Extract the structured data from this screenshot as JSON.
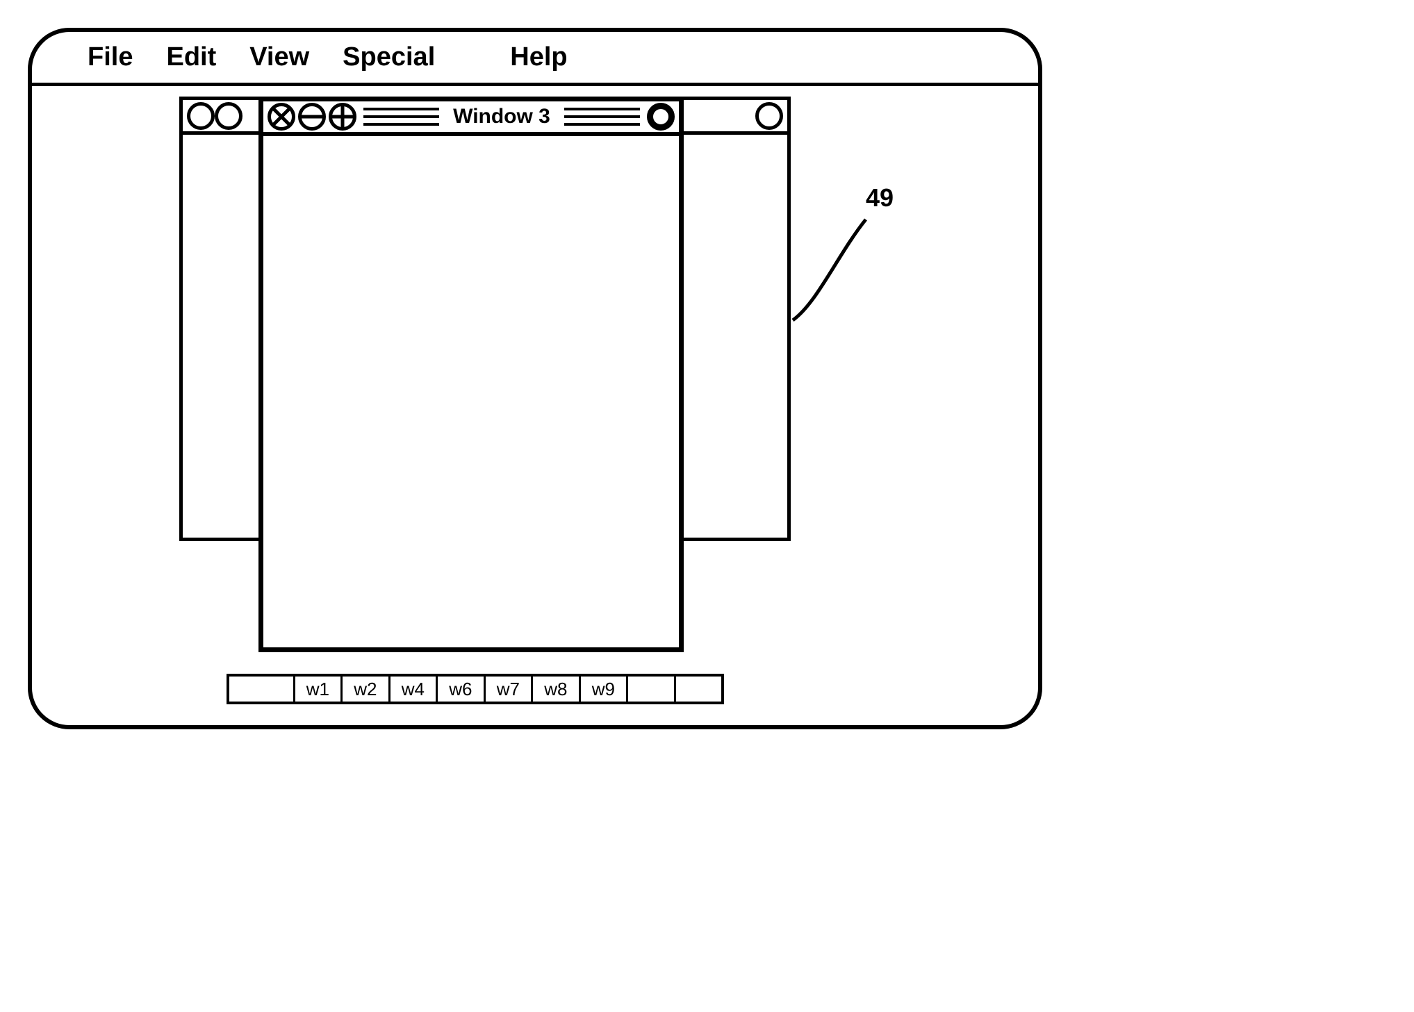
{
  "menubar": {
    "items": [
      "File",
      "Edit",
      "View",
      "Special",
      "Help"
    ]
  },
  "front_window": {
    "title": "Window 3"
  },
  "taskbar": {
    "slots": [
      "",
      "w1",
      "w2",
      "w4",
      "w6",
      "w7",
      "w8",
      "w9",
      "",
      ""
    ]
  },
  "annotation": {
    "label": "49"
  }
}
